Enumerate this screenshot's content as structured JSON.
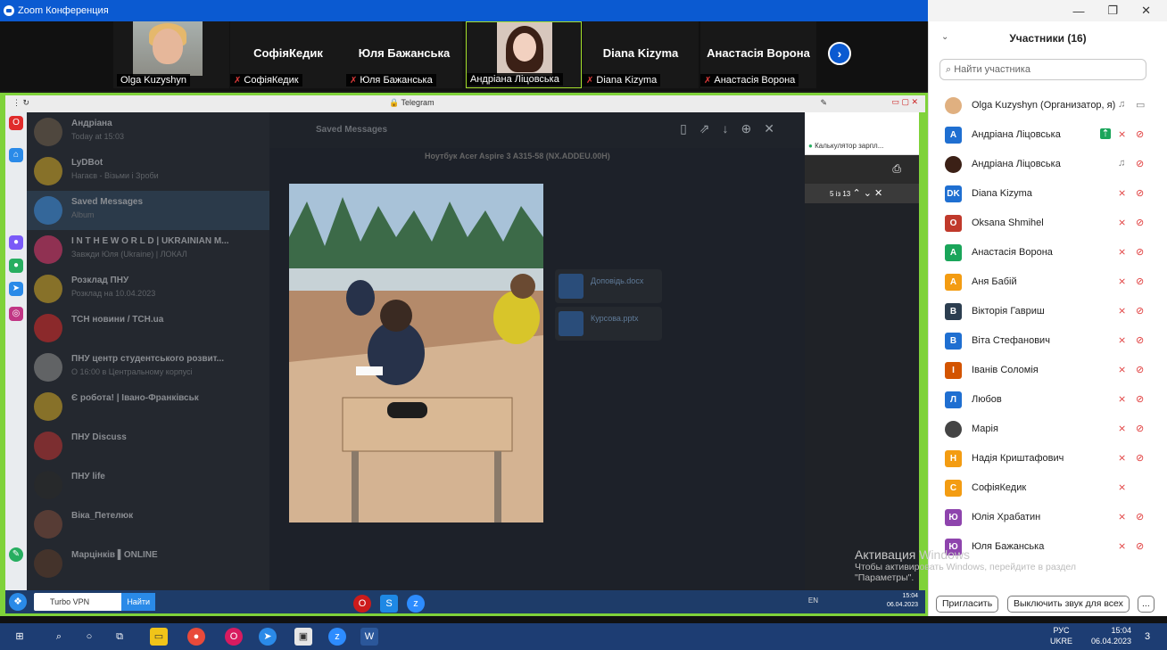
{
  "window": {
    "title": "Zoom Конференция",
    "controls": [
      "—",
      "❐",
      "✕"
    ]
  },
  "strip": {
    "tiles": [
      {
        "id": "olga",
        "label": "Olga Kuzyshyn",
        "muted": false,
        "has_video": true
      },
      {
        "id": "sofia",
        "name": "СофіяКедик",
        "label": "СофіяКедик",
        "muted": true
      },
      {
        "id": "yulia",
        "name": "Юля Бажанська",
        "label": "Юля Бажанська",
        "muted": true
      },
      {
        "id": "andriana",
        "label": "Андріана Ліцовська",
        "muted": false,
        "has_video": true,
        "active": true
      },
      {
        "id": "diana",
        "name": "Diana Kizyma",
        "label": "Diana Kizyma",
        "muted": true
      },
      {
        "id": "anastasia",
        "name": "Анастасія Ворона",
        "label": "Анастасія Ворона",
        "muted": true
      }
    ],
    "next_icon": "chevron-right-icon"
  },
  "shared_screen": {
    "browser_url": "Telegram",
    "telegram": {
      "chats": [
        {
          "title": "Андріана",
          "subtitle": "Today at 15:03",
          "time": "",
          "color": "#6c5b49"
        },
        {
          "title": "LyDBot",
          "subtitle": "Нагаєв - Візьми і Зроби",
          "time": "",
          "color": "#c9a227"
        },
        {
          "title": "Saved Messages",
          "subtitle": "Album",
          "time": "",
          "color": "#3a86d1"
        },
        {
          "title": "I N T H E W O R L D | UKRAINIAN M...",
          "subtitle": "Завжди Юля (Ukraine) | ЛОКАЛ",
          "time": "",
          "color": "#d8376b"
        },
        {
          "title": "Розклад ПНУ",
          "subtitle": "Розклад на 10.04.2023",
          "time": "",
          "color": "#c9a227"
        },
        {
          "title": "ТСН новини / TCH.ua",
          "subtitle": "",
          "time": "",
          "color": "#d02a2a"
        },
        {
          "title": "ПНУ центр студентського розвит...",
          "subtitle": "О 16:00 в Центральному корпусі",
          "time": "",
          "color": "#8b8b8b"
        },
        {
          "title": "Є робота! | Івано-Франківськ",
          "subtitle": "",
          "time": "",
          "color": "#c9a227"
        },
        {
          "title": "ПНУ Discuss",
          "subtitle": "",
          "time": "",
          "color": "#b83232"
        },
        {
          "title": "ПНУ life",
          "subtitle": "",
          "time": "",
          "color": "#2a2a2a"
        },
        {
          "title": "Віка_Петелюк",
          "subtitle": "",
          "time": "",
          "color": "#7a4a3a"
        },
        {
          "title": "Марцінків ▌ONLINE",
          "subtitle": "",
          "time": "",
          "color": "#5a3a2a"
        }
      ],
      "viewer_header": "Saved Messages",
      "file_caption": "Ноутбук Acer Aspire 3 A315-58 (NX.ADDEU.00H)",
      "files": [
        {
          "name": "Доповідь.docx"
        },
        {
          "name": "Курсова.pptx"
        }
      ],
      "counter": "5 із 13",
      "side_link": "Калькулятор зарпл..."
    }
  },
  "panel": {
    "title": "Участники (16)",
    "search_placeholder": "Найти участника",
    "participants": [
      {
        "name": "Olga Kuzyshyn (Организатор, я)",
        "avatar": "",
        "color": "#e0b080",
        "photo": true,
        "mic": "on",
        "video": "on"
      },
      {
        "name": "Андріана Ліцовська",
        "avatar": "A",
        "color": "#1f6fd1",
        "share": true,
        "mic": "off",
        "video": "off"
      },
      {
        "name": "Андріана Ліцовська",
        "avatar": "",
        "color": "#3b2016",
        "photo": true,
        "mic": "on",
        "video": "off"
      },
      {
        "name": "Diana Kizyma",
        "avatar": "DK",
        "color": "#1f6fd1",
        "mic": "off",
        "video": "off"
      },
      {
        "name": "Oksana Shmihel",
        "avatar": "O",
        "color": "#c0392b",
        "mic": "off",
        "video": "off"
      },
      {
        "name": "Анастасія Ворона",
        "avatar": "A",
        "color": "#1aa55a",
        "mic": "off",
        "video": "off"
      },
      {
        "name": "Аня Бабій",
        "avatar": "A",
        "color": "#f39c12",
        "mic": "off",
        "video": "off"
      },
      {
        "name": "Вікторія Гавриш",
        "avatar": "В",
        "color": "#2c3e50",
        "mic": "off",
        "video": "off"
      },
      {
        "name": "Віта Стефанович",
        "avatar": "В",
        "color": "#1f6fd1",
        "mic": "off",
        "video": "off"
      },
      {
        "name": "Іванів Соломія",
        "avatar": "І",
        "color": "#d35400",
        "mic": "off",
        "video": "off"
      },
      {
        "name": "Любов",
        "avatar": "Л",
        "color": "#1f6fd1",
        "mic": "off",
        "video": "off"
      },
      {
        "name": "Марія",
        "avatar": "",
        "color": "#444",
        "photo": true,
        "mic": "off",
        "video": "off"
      },
      {
        "name": "Надія Криштафович",
        "avatar": "Н",
        "color": "#f39c12",
        "mic": "off",
        "video": "off"
      },
      {
        "name": "СофіяКедик",
        "avatar": "С",
        "color": "#f39c12",
        "mic": "off",
        "video": "none"
      },
      {
        "name": "Юлія Храбатин",
        "avatar": "Ю",
        "color": "#8e44ad",
        "mic": "off",
        "video": "off"
      },
      {
        "name": "Юля Бажанська",
        "avatar": "Ю",
        "color": "#8e44ad",
        "mic": "off",
        "video": "off"
      }
    ],
    "invite_label": "Пригласить",
    "mute_all_label": "Выключить звук для всех",
    "more_label": "..."
  },
  "watermark": {
    "title": "Активация Windows",
    "text": "Чтобы активировать Windows, перейдите в раздел \"Параметры\"."
  },
  "taskbar": {
    "lang": "РУС",
    "lang2": "UKRE",
    "time": "15:04",
    "date": "06.04.2023",
    "notif": "3"
  },
  "inner_taskbar": {
    "vpn": "Turbo VPN",
    "search_btn": "Найти",
    "lang": "EN",
    "time": "15:04",
    "date": "06.04.2023"
  }
}
